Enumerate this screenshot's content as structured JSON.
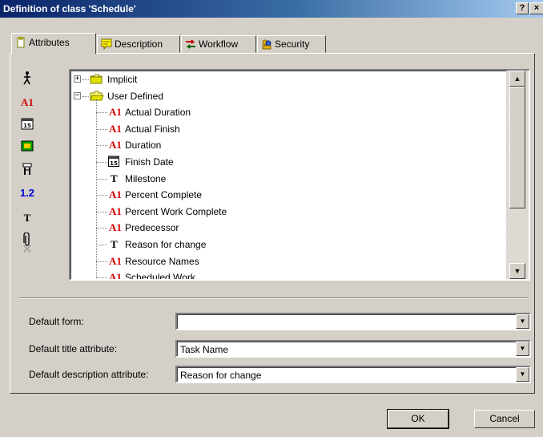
{
  "window": {
    "title": "Definition of class 'Schedule'",
    "help_label": "?",
    "close_label": "×"
  },
  "tabs": [
    {
      "label": "Attributes",
      "active": true
    },
    {
      "label": "Description",
      "active": false
    },
    {
      "label": "Workflow",
      "active": false
    },
    {
      "label": "Security",
      "active": false
    }
  ],
  "toolbar": {
    "items": [
      {
        "icon": "person-icon",
        "glyph": "⽊"
      },
      {
        "icon": "text-attribute-icon",
        "glyph": "A1"
      },
      {
        "icon": "date-attribute-icon",
        "glyph": "15"
      },
      {
        "icon": "image-attribute-icon",
        "glyph": "■"
      },
      {
        "icon": "list-attribute-icon",
        "glyph": "☰"
      },
      {
        "icon": "number-attribute-icon",
        "glyph": "1.2"
      },
      {
        "icon": "memo-attribute-icon",
        "glyph": "T"
      },
      {
        "icon": "attachment-icon",
        "glyph": "⌽"
      },
      {
        "icon": "delete-icon",
        "glyph": "✕"
      }
    ]
  },
  "tree": {
    "groups": [
      {
        "label": "Implicit",
        "expanded": false
      },
      {
        "label": "User Defined",
        "expanded": true
      }
    ],
    "items": [
      {
        "type": "A1",
        "label": "Actual Duration"
      },
      {
        "type": "A1",
        "label": "Actual Finish"
      },
      {
        "type": "A1",
        "label": "Duration"
      },
      {
        "type": "date",
        "label": "Finish Date"
      },
      {
        "type": "T",
        "label": "Milestone"
      },
      {
        "type": "A1",
        "label": "Percent Complete"
      },
      {
        "type": "A1",
        "label": "Percent Work Complete"
      },
      {
        "type": "A1",
        "label": "Predecessor"
      },
      {
        "type": "T",
        "label": "Reason for change"
      },
      {
        "type": "A1",
        "label": "Resource Names"
      },
      {
        "type": "A1",
        "label": "Scheduled Work"
      }
    ],
    "type_glyphs": {
      "A1": "A1",
      "T": "T",
      "date": "15"
    }
  },
  "form": {
    "default_form_label": "Default form:",
    "default_form_value": "",
    "default_title_label": "Default title attribute:",
    "default_title_value": "Task Name",
    "default_description_label": "Default description attribute:",
    "default_description_value": "Reason for change"
  },
  "buttons": {
    "ok": "OK",
    "cancel": "Cancel"
  },
  "colors": {
    "titlebar": "#0a246a",
    "a1_red": "#d40000",
    "number_blue": "#0000cc",
    "face": "#d4d0c8"
  }
}
